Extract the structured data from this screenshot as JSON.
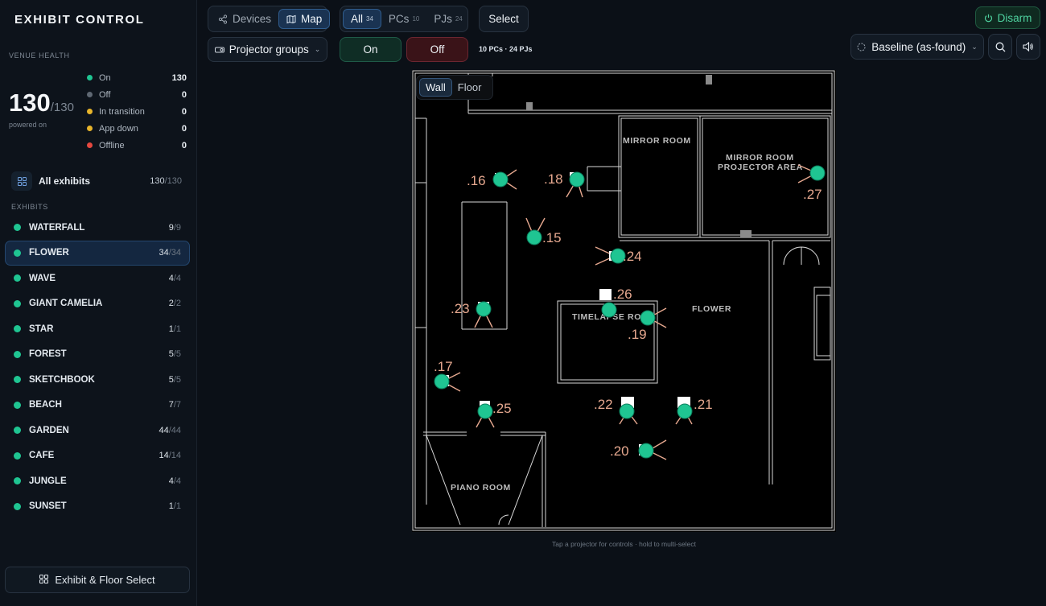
{
  "app": {
    "title": "EXHIBIT CONTROL"
  },
  "venue_health": {
    "label": "VENUE HEALTH",
    "powered_count": "130",
    "powered_total": "/130",
    "powered_label": "powered on",
    "statuses": [
      {
        "label": "On",
        "count": "130",
        "color": "#1fc592"
      },
      {
        "label": "Off",
        "count": "0",
        "color": "#5f6873"
      },
      {
        "label": "In transition",
        "count": "0",
        "color": "#e8b52b"
      },
      {
        "label": "App down",
        "count": "0",
        "color": "#e8b52b"
      },
      {
        "label": "Offline",
        "count": "0",
        "color": "#e5483f"
      }
    ]
  },
  "all_exhibits": {
    "label": "All exhibits",
    "count": "130",
    "total": "/130",
    "icon": "grid-icon"
  },
  "exhibits_label": "EXHIBITS",
  "exhibits": [
    {
      "name": "WATERFALL",
      "count": "9",
      "total": "/9"
    },
    {
      "name": "FLOWER",
      "count": "34",
      "total": "/34",
      "active": true
    },
    {
      "name": "WAVE",
      "count": "4",
      "total": "/4"
    },
    {
      "name": "GIANT CAMELIA",
      "count": "2",
      "total": "/2"
    },
    {
      "name": "STAR",
      "count": "1",
      "total": "/1"
    },
    {
      "name": "FOREST",
      "count": "5",
      "total": "/5"
    },
    {
      "name": "SKETCHBOOK",
      "count": "5",
      "total": "/5"
    },
    {
      "name": "BEACH",
      "count": "7",
      "total": "/7"
    },
    {
      "name": "GARDEN",
      "count": "44",
      "total": "/44"
    },
    {
      "name": "CAFE",
      "count": "14",
      "total": "/14"
    },
    {
      "name": "JUNGLE",
      "count": "4",
      "total": "/4"
    },
    {
      "name": "SUNSET",
      "count": "1",
      "total": "/1"
    }
  ],
  "floor_select_label": "Exhibit & Floor Select",
  "toolbar": {
    "devices": "Devices",
    "map": "Map",
    "filter_all": "All",
    "filter_all_count": "34",
    "filter_pcs": "PCs",
    "filter_pcs_count": "10",
    "filter_pjs": "PJs",
    "filter_pjs_count": "24",
    "select": "Select",
    "group": "Projector groups",
    "on": "On",
    "off": "Off",
    "device_counts": "10 PCs · 24 PJs",
    "disarm": "Disarm",
    "baseline": "Baseline (as-found)"
  },
  "map": {
    "view_wall": "Wall",
    "view_floor": "Floor",
    "rooms": {
      "mirror_room": "MIRROR ROOM",
      "mirror_projector_1": "MIRROR ROOM",
      "mirror_projector_2": "PROJECTOR AREA",
      "timelapse": "TIMELAPSE ROOM",
      "flower": "FLOWER",
      "piano": "PIANO ROOM"
    },
    "projectors": [
      {
        "label": ".16"
      },
      {
        "label": ".18"
      },
      {
        "label": ".27"
      },
      {
        "label": ".15"
      },
      {
        "label": ".24"
      },
      {
        "label": ".26"
      },
      {
        "label": ".23"
      },
      {
        "label": ".19"
      },
      {
        "label": ".17"
      },
      {
        "label": ".25"
      },
      {
        "label": ".22"
      },
      {
        "label": ".21"
      },
      {
        "label": ".20"
      }
    ],
    "hint": "Tap a projector for controls · hold to multi-select"
  }
}
